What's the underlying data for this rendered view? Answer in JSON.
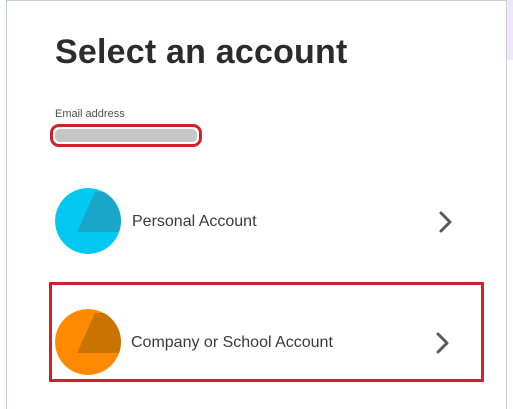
{
  "page": {
    "title": "Select an account"
  },
  "email": {
    "label": "Email address",
    "value_redacted": true
  },
  "accounts": [
    {
      "label": "Personal Account",
      "icon": "chevron-right-icon",
      "avatar_color": "#00c8f0",
      "avatar_shade": "#1aa6c9"
    },
    {
      "label": "Company or School Account",
      "icon": "chevron-right-icon",
      "avatar_color": "#ff8a00",
      "avatar_shade": "#c97400"
    }
  ],
  "highlight_color": "#d0212d"
}
